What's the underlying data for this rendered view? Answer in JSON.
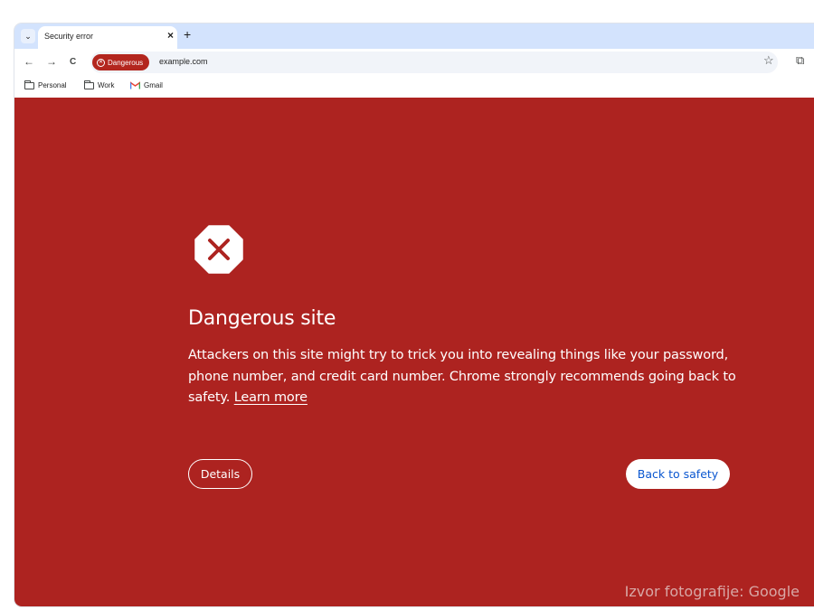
{
  "tab": {
    "title": "Security error",
    "close_glyph": "×",
    "new_tab_glyph": "+",
    "search_glyph": "⌄"
  },
  "toolbar": {
    "back_glyph": "←",
    "forward_glyph": "→",
    "reload_glyph": "C",
    "danger_chip_label": "Dangerous",
    "url": "example.com",
    "star_glyph": "☆",
    "extensions_glyph": "⧉"
  },
  "bookmarks": [
    {
      "label": "Personal",
      "icon": "folder-icon"
    },
    {
      "label": "Work",
      "icon": "folder-icon"
    },
    {
      "label": "Gmail",
      "icon": "gmail-icon"
    }
  ],
  "interstitial": {
    "heading": "Dangerous site",
    "message": "Attackers on this site might try to trick you into revealing things like your password, phone number, and credit card number. Chrome strongly recommends going back to safety.",
    "learn_more": "Learn more",
    "details_button": "Details",
    "safety_button": "Back to safety"
  },
  "credit": "Izvor fotografije: Google",
  "colors": {
    "danger_background": "#ad2320",
    "chip_red": "#b3261e",
    "tab_strip": "#d3e3fd",
    "primary_blue": "#0b57d0"
  }
}
